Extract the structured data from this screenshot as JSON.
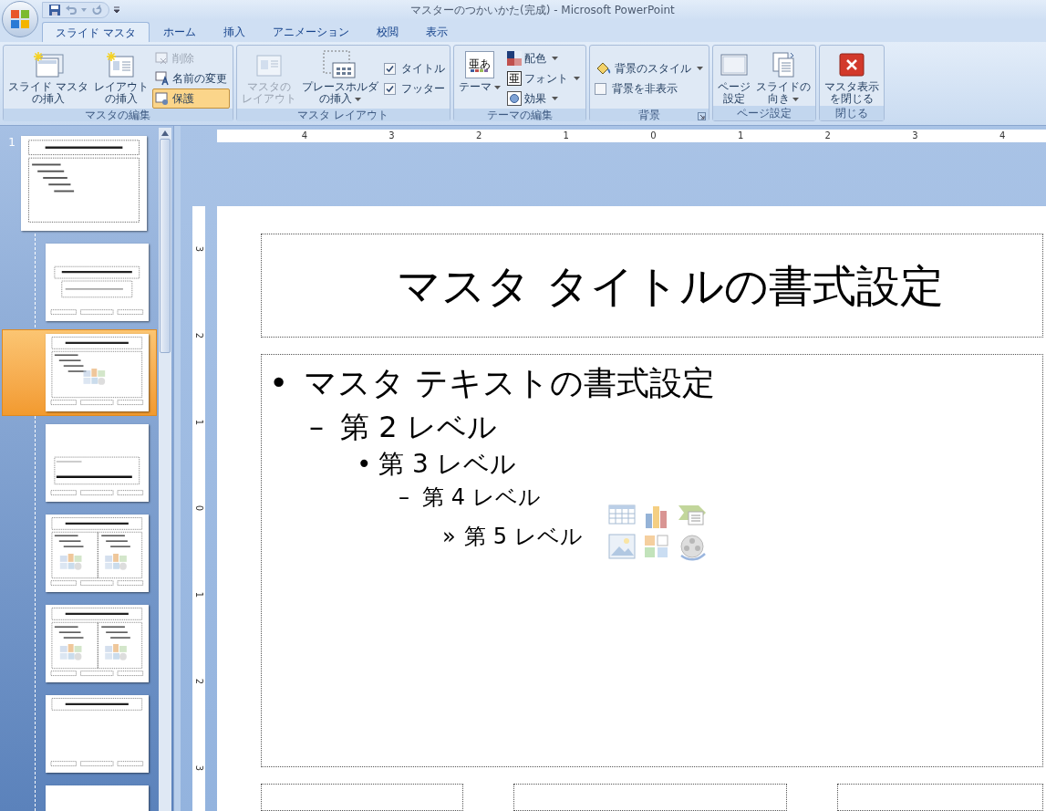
{
  "window": {
    "title": "マスターのつかいかた(完成) - Microsoft PowerPoint"
  },
  "tabs": [
    {
      "label": "スライド マスタ",
      "selected": true
    },
    {
      "label": "ホーム",
      "selected": false
    },
    {
      "label": "挿入",
      "selected": false
    },
    {
      "label": "アニメーション",
      "selected": false
    },
    {
      "label": "校閲",
      "selected": false
    },
    {
      "label": "表示",
      "selected": false
    }
  ],
  "ribbon": {
    "groups": [
      {
        "label": "マスタの編集",
        "launcher": false,
        "items": [
          {
            "kind": "large",
            "lines": [
              "スライド マスタ",
              "の挿入"
            ],
            "disabled": false,
            "dropdown": false
          },
          {
            "kind": "large",
            "lines": [
              "レイアウト",
              "の挿入"
            ],
            "disabled": false,
            "dropdown": false
          },
          {
            "kind": "stack",
            "items": [
              {
                "kind": "small",
                "label": "削除",
                "disabled": true,
                "selected": false,
                "dropdown": false
              },
              {
                "kind": "small",
                "label": "名前の変更",
                "disabled": false,
                "selected": false,
                "dropdown": false
              },
              {
                "kind": "small",
                "label": "保護",
                "disabled": false,
                "selected": true,
                "dropdown": false
              }
            ]
          }
        ]
      },
      {
        "label": "マスタ レイアウト",
        "launcher": false,
        "items": [
          {
            "kind": "large",
            "lines": [
              "マスタの",
              "レイアウト"
            ],
            "disabled": true,
            "dropdown": false
          },
          {
            "kind": "large",
            "lines": [
              "プレースホルダ",
              "の挿入"
            ],
            "disabled": false,
            "dropdown": true
          },
          {
            "kind": "stack",
            "items": [
              {
                "kind": "checkbox",
                "label": "タイトル",
                "checked": true
              },
              {
                "kind": "checkbox",
                "label": "フッター",
                "checked": true
              }
            ]
          }
        ]
      },
      {
        "label": "テーマの編集",
        "launcher": false,
        "items": [
          {
            "kind": "large",
            "lines": [
              "テーマ"
            ],
            "disabled": false,
            "dropdown": true,
            "preview_text": "亜あ"
          },
          {
            "kind": "stack",
            "items": [
              {
                "kind": "small",
                "label": "配色",
                "disabled": false,
                "selected": false,
                "dropdown": true
              },
              {
                "kind": "small",
                "label": "フォント",
                "disabled": false,
                "selected": false,
                "dropdown": true,
                "icon_text": "亜"
              },
              {
                "kind": "small",
                "label": "効果",
                "disabled": false,
                "selected": false,
                "dropdown": true
              }
            ]
          }
        ]
      },
      {
        "label": "背景",
        "launcher": true,
        "items": [
          {
            "kind": "stack",
            "items": [
              {
                "kind": "small",
                "label": "背景のスタイル",
                "disabled": false,
                "selected": false,
                "dropdown": true
              },
              {
                "kind": "checkbox",
                "label": "背景を非表示",
                "checked": false
              }
            ]
          }
        ]
      },
      {
        "label": "ページ設定",
        "launcher": false,
        "items": [
          {
            "kind": "large",
            "lines": [
              "ページ",
              "設定"
            ],
            "disabled": false,
            "dropdown": false
          },
          {
            "kind": "large",
            "lines": [
              "スライドの",
              "向き"
            ],
            "disabled": false,
            "dropdown": true
          }
        ]
      },
      {
        "label": "閉じる",
        "launcher": false,
        "items": [
          {
            "kind": "large",
            "lines": [
              "マスタ表示",
              "を閉じる"
            ],
            "disabled": false,
            "dropdown": false
          }
        ]
      }
    ]
  },
  "thumbnails": [
    {
      "kind": "master",
      "number": "1",
      "selected": false
    },
    {
      "kind": "title_slide",
      "selected": false
    },
    {
      "kind": "title_content",
      "selected": true
    },
    {
      "kind": "section",
      "selected": false
    },
    {
      "kind": "two_content",
      "selected": false
    },
    {
      "kind": "comparison",
      "selected": false
    },
    {
      "kind": "title_only",
      "selected": false
    },
    {
      "kind": "blank",
      "selected": false
    }
  ],
  "rulers": {
    "horizontal": [
      "4",
      "3",
      "2",
      "1",
      "0",
      "1",
      "2",
      "3",
      "4"
    ],
    "vertical": [
      "3",
      "2",
      "1",
      "0",
      "1",
      "2",
      "3"
    ]
  },
  "slide": {
    "title": "マスタ タイトルの書式設定",
    "levels": [
      {
        "marker": "•",
        "text": "マスタ テキストの書式設定"
      },
      {
        "marker": "–",
        "text": "第 2 レベル"
      },
      {
        "marker": "•",
        "text": "第 3 レベル"
      },
      {
        "marker": "–",
        "text": "第 4 レベル"
      },
      {
        "marker": "»",
        "text": "第 5 レベル"
      }
    ]
  }
}
